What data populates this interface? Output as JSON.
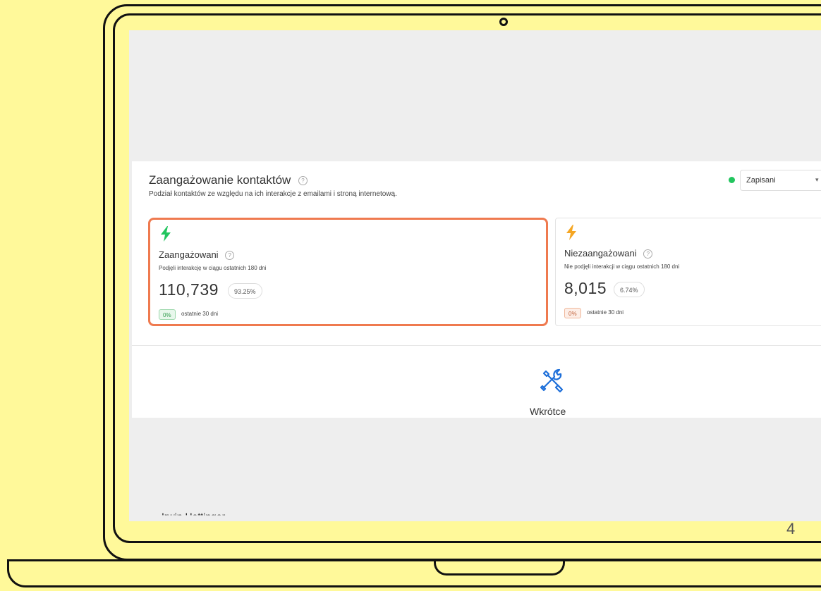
{
  "engagement": {
    "title": "Zaangażowanie kontaktów",
    "help_symbol": "?",
    "subtitle": "Podział kontaktów ze względu na ich interakcje z emailami i stroną internetową.",
    "status_filter": "Zapisani",
    "select_arrow": "▾",
    "status_color": "#22c55e"
  },
  "cards": [
    {
      "icon": "lightning-bolt-icon",
      "icon_color": "#22c55e",
      "title": "Zaangażowani",
      "description": "Podjęli interakcję w ciągu ostatnich 180 dni",
      "count": "110,739",
      "percent": "93.25%",
      "trend": "0%",
      "trend_label": "ostatnie 30 dni",
      "highlighted": true
    },
    {
      "icon": "lightning-bolt-icon",
      "icon_color": "#f5a623",
      "title": "Niezaangażowani",
      "description": "Nie podjęli interakcji w ciągu ostatnich 180 dni",
      "count": "8,015",
      "percent": "6.74%",
      "trend": "0%",
      "trend_label": "ostatnie 30 dni",
      "highlighted": false
    }
  ],
  "coming_soon": {
    "icon": "tools-icon",
    "label": "Wkrótce"
  },
  "behind_row_text": "Irwin Hettinger",
  "page_number": "4",
  "colors": {
    "background": "#fff99a",
    "highlight_border": "#ef7a4f",
    "accent_blue": "#1e6fd9"
  }
}
